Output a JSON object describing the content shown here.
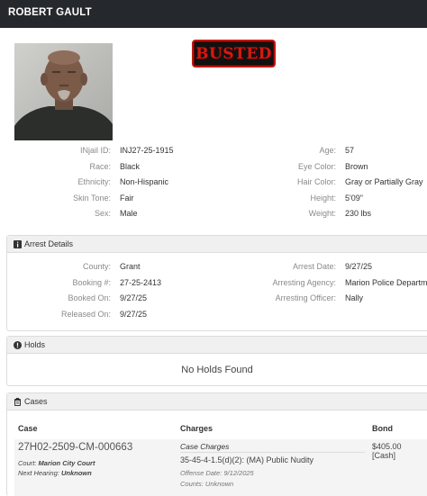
{
  "header": {
    "name": "ROBERT GAULT"
  },
  "badge": {
    "text": "BUSTED"
  },
  "profile": {
    "left": [
      {
        "key": "INjail ID:",
        "value": "INJ27-25-1915"
      },
      {
        "key": "Race:",
        "value": "Black"
      },
      {
        "key": "Ethnicity:",
        "value": "Non-Hispanic"
      },
      {
        "key": "Skin Tone:",
        "value": "Fair"
      },
      {
        "key": "Sex:",
        "value": "Male"
      }
    ],
    "right": [
      {
        "key": "Age:",
        "value": "57"
      },
      {
        "key": "Eye Color:",
        "value": "Brown"
      },
      {
        "key": "Hair Color:",
        "value": "Gray or Partially Gray"
      },
      {
        "key": "Height:",
        "value": "5'09\""
      },
      {
        "key": "Weight:",
        "value": "230 lbs"
      }
    ]
  },
  "arrest": {
    "title": "Arrest Details",
    "left": [
      {
        "key": "County:",
        "value": "Grant"
      },
      {
        "key": "Booking #:",
        "value": "27-25-2413"
      },
      {
        "key": "Booked On:",
        "value": "9/27/25"
      },
      {
        "key": "Released On:",
        "value": "9/27/25"
      }
    ],
    "right": [
      {
        "key": "Arrest Date:",
        "value": "9/27/25"
      },
      {
        "key": "Arresting Agency:",
        "value": "Marion Police Departm"
      },
      {
        "key": "Arresting Officer:",
        "value": "Nally"
      }
    ]
  },
  "holds": {
    "title": "Holds",
    "empty_text": "No Holds Found"
  },
  "cases": {
    "title": "Cases",
    "columns": {
      "case": "Case",
      "charges": "Charges",
      "bond": "Bond"
    },
    "rows": [
      {
        "case_number": "27H02-2509-CM-000663",
        "court_label": "Court:",
        "court": "Marion City Court",
        "next_hearing_label": "Next Hearing:",
        "next_hearing": "Unknown",
        "charges_title": "Case Charges",
        "charge": "35-45-4-1.5(d)(2): (MA) Public Nudity",
        "offense_date": "Offense Date: 9/12/2025",
        "counts": "Counts: Unknown",
        "bond": "$405.00 [Cash]"
      }
    ]
  },
  "icons": {
    "info": "info-icon",
    "alert": "exclamation-icon",
    "clipboard": "clipboard-icon"
  }
}
